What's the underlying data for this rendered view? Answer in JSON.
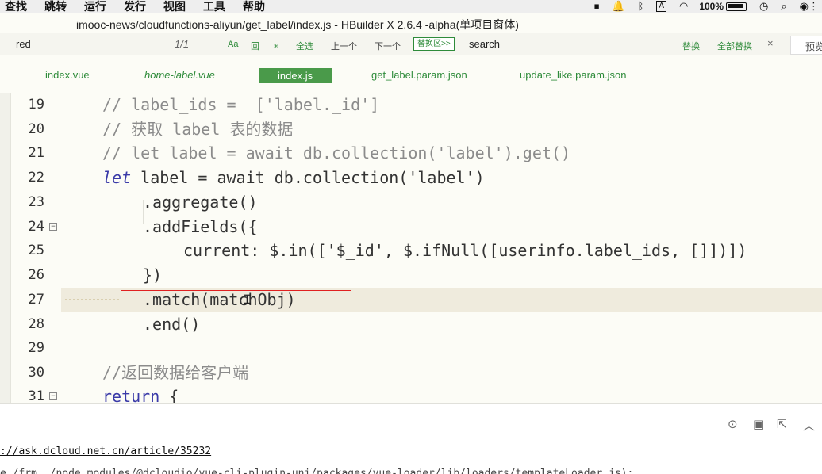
{
  "menubar": {
    "items": [
      "查找",
      "跳转",
      "运行",
      "发行",
      "视图",
      "工具",
      "帮助"
    ],
    "battery": "100%"
  },
  "window_title": "imooc-news/cloudfunctions-aliyun/get_label/index.js - HBuilder X 2.6.4 -alpha(单项目窗体)",
  "findbar": {
    "find_value": "red",
    "match_count": "1/1",
    "option_case": "Aa",
    "option_word": "回",
    "option_regex": "⁎",
    "select_all": "全选",
    "prev": "上一个",
    "next": "下一个",
    "replace_area": "替换区>>",
    "replace_value": "search",
    "replace": "替换",
    "replace_all": "全部替换",
    "close": "×",
    "preview": "预览"
  },
  "tabs": [
    {
      "label": "index.vue"
    },
    {
      "label": "home-label.vue"
    },
    {
      "label": "index.js"
    },
    {
      "label": "get_label.param.json"
    },
    {
      "label": "update_like.param.json"
    }
  ],
  "editor": {
    "line_numbers": [
      "19",
      "20",
      "21",
      "22",
      "23",
      "24",
      "25",
      "26",
      "27",
      "28",
      "29",
      "30",
      "31"
    ],
    "l19": "// label_ids =  ['label._id']",
    "l20": "// 获取 label 表的数据",
    "l21": "// let label = await db.collection('label').get()",
    "l22_kw": "let",
    "l22_rest": " label = await db.collection('label')",
    "l23": ".aggregate()",
    "l24": ".addFields({",
    "l25": "current: $.in(['$_id', $.ifNull([userinfo.label_ids, []])])",
    "l26": "})",
    "l27": ".match(matchObj)",
    "l28": ".end()",
    "l29": "",
    "l30": "//返回数据给客户端",
    "l31_kw": "return",
    "l31_rest": " {"
  },
  "console": {
    "link": "://ask.dcloud.net.cn/article/35232",
    "partial_line": "e /frm ./node_modules/@dcloudio/vue-cli-plugin-uni/packages/vue-loader/lib/loaders/templateLoader.js):"
  }
}
